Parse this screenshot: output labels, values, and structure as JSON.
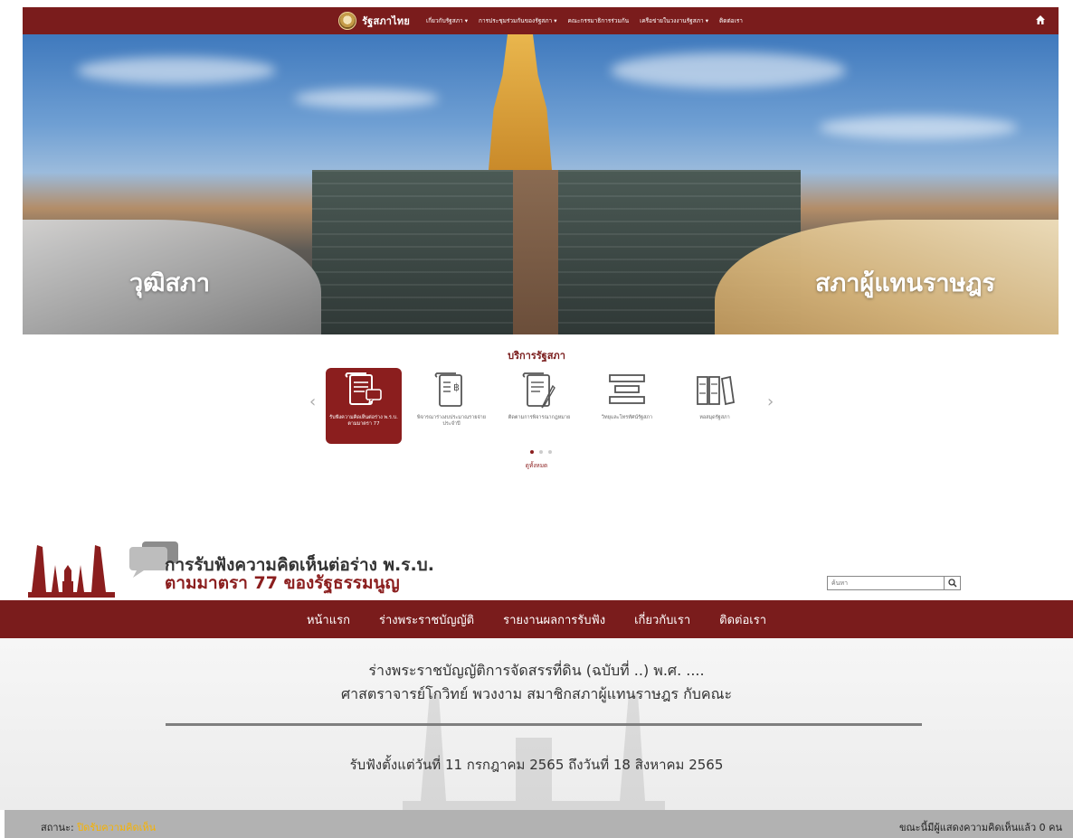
{
  "topnav": {
    "brand": "รัฐสภาไทย",
    "menu": [
      "เกี่ยวกับรัฐสภา ▾",
      "การประชุมร่วมกันของรัฐสภา ▾",
      "คณะกรรมาธิการร่วมกัน",
      "เครือข่ายในวงงานรัฐสภา ▾",
      "ติดต่อเรา"
    ],
    "home_icon": "home-icon"
  },
  "hero": {
    "left_label": "วุฒิสภา",
    "right_label": "สภาผู้แทนราษฎร"
  },
  "services": {
    "title": "บริการรัฐสภา",
    "items": [
      {
        "label": "รับฟังความคิดเห็นต่อร่าง พ.ร.บ. ตามมาตรา 77",
        "icon": "comment-document-icon",
        "active": true
      },
      {
        "label": "พิจารณาร่างงบประมาณรายจ่ายประจำปี",
        "icon": "budget-document-icon",
        "active": false
      },
      {
        "label": "ติดตามการพิจารณากฎหมาย",
        "icon": "law-tracking-icon",
        "active": false
      },
      {
        "label": "วิทยุและโทรทัศน์รัฐสภา",
        "icon": "broadcast-icon",
        "active": false
      },
      {
        "label": "หอสมุดรัฐสภา",
        "icon": "library-icon",
        "active": false
      }
    ],
    "see_all": "ดูทั้งหมด",
    "accent": "#8b1e1e"
  },
  "hearing": {
    "title_line1": "การรับฟังความคิดเห็นต่อร่าง พ.ร.บ.",
    "title_line2": "ตามมาตรา 77 ของรัฐธรรมนูญ",
    "search_placeholder": "ค้นหา",
    "nav": [
      "หน้าแรก",
      "ร่างพระราชบัญญัติ",
      "รายงานผลการรับฟัง",
      "เกี่ยวกับเรา",
      "ติดต่อเรา"
    ],
    "bill_title": "ร่างพระราชบัญญัติการจัดสรรที่ดิน (ฉบับที่ ..) พ.ศ. ....",
    "proposer": "ศาสตราจารย์โกวิทย์ พวงงาม สมาชิกสภาผู้แทนราษฎร กับคณะ",
    "period": "รับฟังตั้งแต่วันที่ 11 กรกฎาคม 2565 ถึงวันที่ 18 สิงหาคม 2565",
    "status_label": "สถานะ:",
    "status_value": "ปิดรับความคิดเห็น",
    "comment_count_text": "ขณะนี้มีผู้แสดงความคิดเห็นแล้ว 0 คน",
    "primary_color": "#7a1c1c"
  }
}
